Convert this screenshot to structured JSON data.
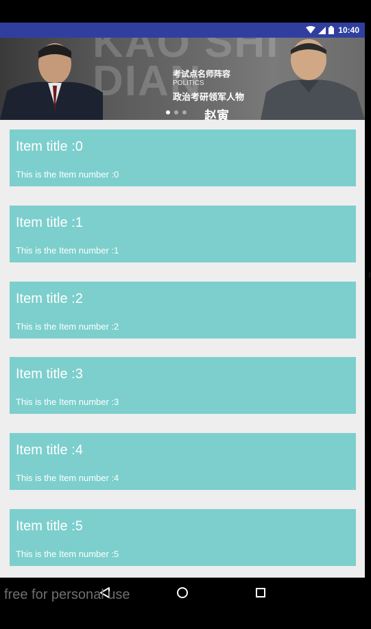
{
  "status_bar": {
    "time": "10:40",
    "icons": [
      "wifi-icon",
      "signal-icon",
      "battery-icon"
    ],
    "background": "#303f9f"
  },
  "banner": {
    "bg_text": "KAO SHI DIAN",
    "caption_line1": "考试点名师阵容",
    "caption_line2": "POLITICS",
    "caption_line3": "政治考研领军人物",
    "caption_name": "赵寅",
    "pages": 3,
    "active_page": 1
  },
  "items": [
    {
      "title": "Item title :0",
      "subtitle": "This is the Item number :0"
    },
    {
      "title": "Item title :1",
      "subtitle": "This is the Item number :1"
    },
    {
      "title": "Item title :2",
      "subtitle": "This is the Item number :2"
    },
    {
      "title": "Item title :3",
      "subtitle": "This is the Item number :3"
    },
    {
      "title": "Item title :4",
      "subtitle": "This is the Item number :4"
    },
    {
      "title": "Item title :5",
      "subtitle": "This is the Item number :5"
    }
  ],
  "card_color": "#7ccfcd",
  "list_background": "#eeeeee",
  "navigation": {
    "buttons": [
      "back-icon",
      "home-icon",
      "recents-icon"
    ]
  },
  "watermark": "free for personal use"
}
